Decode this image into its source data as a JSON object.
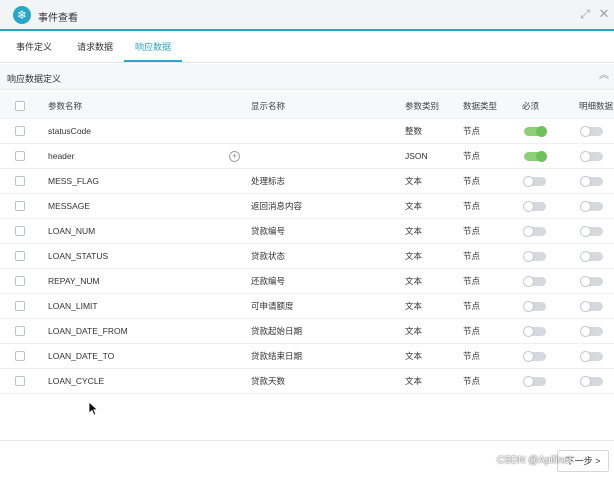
{
  "window": {
    "title": "事件查看",
    "logo_glyph": "❄",
    "maximize_glyph": "⤢",
    "close_glyph": "✕"
  },
  "tabs": [
    {
      "label": "事件定义",
      "active": false
    },
    {
      "label": "请求数据",
      "active": false
    },
    {
      "label": "响应数据",
      "active": true
    }
  ],
  "section": {
    "title": "响应数据定义",
    "collapse_glyph": "︽"
  },
  "table": {
    "columns": [
      "参数名称",
      "显示名称",
      "参数类别",
      "数据类型",
      "必须",
      "明细数据"
    ],
    "rows": [
      {
        "name": "statusCode",
        "display": "",
        "ptype": "整数",
        "dtype": "节点",
        "required": true,
        "detail": false
      },
      {
        "name": "header",
        "display": "",
        "ptype": "JSON",
        "dtype": "节点",
        "required": true,
        "detail": false
      },
      {
        "name": "MESS_FLAG",
        "display": "处理标志",
        "ptype": "文本",
        "dtype": "节点",
        "required": false,
        "detail": false
      },
      {
        "name": "MESSAGE",
        "display": "返回消息内容",
        "ptype": "文本",
        "dtype": "节点",
        "required": false,
        "detail": false
      },
      {
        "name": "LOAN_NUM",
        "display": "贷款编号",
        "ptype": "文本",
        "dtype": "节点",
        "required": false,
        "detail": false
      },
      {
        "name": "LOAN_STATUS",
        "display": "贷款状态",
        "ptype": "文本",
        "dtype": "节点",
        "required": false,
        "detail": false
      },
      {
        "name": "REPAY_NUM",
        "display": "还款编号",
        "ptype": "文本",
        "dtype": "节点",
        "required": false,
        "detail": false
      },
      {
        "name": "LOAN_LIMIT",
        "display": "可申请额度",
        "ptype": "文本",
        "dtype": "节点",
        "required": false,
        "detail": false
      },
      {
        "name": "LOAN_DATE_FROM",
        "display": "贷款起始日期",
        "ptype": "文本",
        "dtype": "节点",
        "required": false,
        "detail": false
      },
      {
        "name": "LOAN_DATE_TO",
        "display": "贷款结束日期",
        "ptype": "文本",
        "dtype": "节点",
        "required": false,
        "detail": false
      },
      {
        "name": "LOAN_CYCLE",
        "display": "贷款天数",
        "ptype": "文本",
        "dtype": "节点",
        "required": false,
        "detail": false
      }
    ],
    "add_glyph": "+"
  },
  "footer": {
    "next_label": "下一步 >"
  },
  "watermark": "CSDN @Apifinet",
  "colors": {
    "accent": "#2aa7c7",
    "toggle_on": "#6cc35a",
    "toggle_off": "#d5d9dd"
  }
}
